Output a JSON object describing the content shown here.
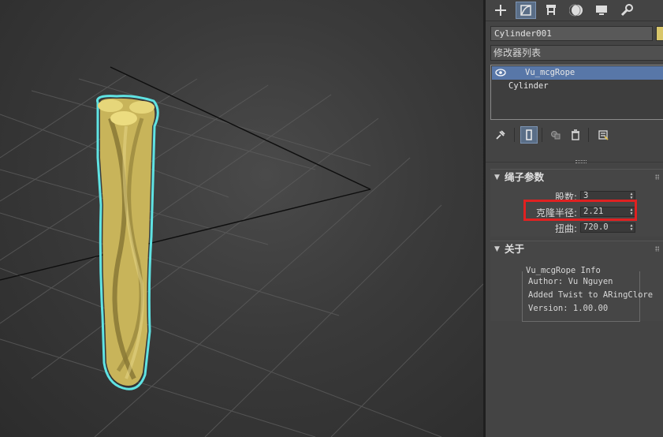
{
  "toolbar": {
    "tabs": [
      {
        "icon": "create-icon"
      },
      {
        "icon": "modify-icon"
      },
      {
        "icon": "hierarchy-icon"
      },
      {
        "icon": "motion-icon"
      },
      {
        "icon": "display-icon"
      },
      {
        "icon": "utilities-icon"
      }
    ],
    "active_tab": "modify"
  },
  "object": {
    "name": "Cylinder001",
    "color": "#d8c66a"
  },
  "modifier_list": {
    "label": "修改器列表"
  },
  "stack": {
    "items": [
      {
        "label": "Vu_mcgRope",
        "selected": true
      },
      {
        "label": "Cylinder",
        "selected": false
      }
    ]
  },
  "stack_tools": [
    "pin-stack-icon",
    "show-end-result-icon",
    "make-unique-icon",
    "remove-modifier-icon",
    "configure-sets-icon"
  ],
  "rope_params": {
    "title": "绳子参数",
    "strands_label": "股数:",
    "strands_value": "3",
    "radius_label": "克隆半径:",
    "radius_value": "2.21",
    "twist_label": "扭曲:",
    "twist_value": "720.0"
  },
  "about": {
    "title": "关于",
    "group_title": "Vu_mcgRope Info",
    "author": "Author: Vu Nguyen",
    "note": "Added Twist to ARingClore",
    "version": "Version: 1.00.00"
  },
  "colors": {
    "selection_blue": "#5877a8",
    "highlight_red": "#e02121",
    "rope_yellow": "#d8c66a",
    "selection_outline": "#5fe3e3"
  }
}
